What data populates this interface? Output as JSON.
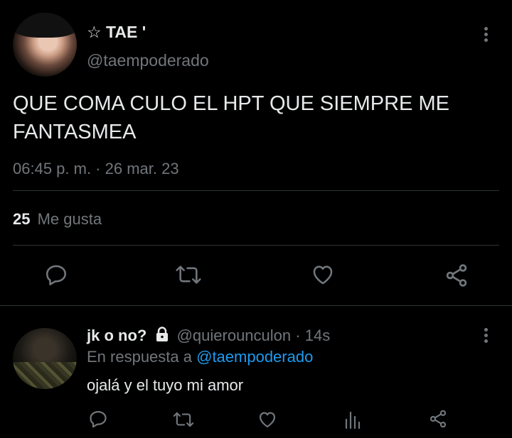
{
  "tweet": {
    "display_name": "☆ TAE '",
    "handle": "@taempoderado",
    "text_line1": "QUE COMA CULO EL HPT QUE SIEMPRE ME",
    "text_line2": "FANTASMEA",
    "timestamp": "06:45 p. m. · 26 mar. 23",
    "likes_count": "25",
    "likes_label": "Me gusta"
  },
  "reply": {
    "display_name": "jk o no?",
    "handle": "@quierounculon",
    "separator": "·",
    "time": "14s",
    "reply_prefix": "En respuesta a",
    "reply_to": "@taempoderado",
    "text": "ojalá y el tuyo mi amor"
  },
  "colors": {
    "background": "#000000",
    "text": "#e7e9ea",
    "muted": "#71767b",
    "link": "#1d9bf0",
    "divider": "#2f3336"
  }
}
